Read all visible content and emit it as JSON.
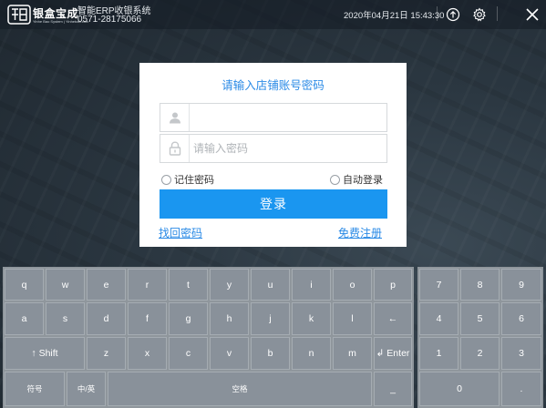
{
  "titlebar": {
    "brand_name": "银盒宝成",
    "brand_sub": "Yinhe Bao System | Yinhebao.com",
    "app_name": "智能ERP收银系统",
    "phone": "0571-28175066",
    "datetime": "2020年04月21日 15:43:30",
    "upload_icon": "upload-circle-icon",
    "settings_icon": "gear-icon",
    "close_icon": "close-icon"
  },
  "login": {
    "title": "请输入店铺账号密码",
    "username_value": "",
    "username_placeholder": "",
    "password_value": "",
    "password_placeholder": "请输入密码",
    "remember_label": "记住密码",
    "auto_login_label": "自动登录",
    "login_button": "登录",
    "forgot_link": "找回密码",
    "register_link": "免费注册"
  },
  "keyboard": {
    "row1": [
      "q",
      "w",
      "e",
      "r",
      "t",
      "y",
      "u",
      "i",
      "o",
      "p"
    ],
    "row2": [
      "a",
      "s",
      "d",
      "f",
      "g",
      "h",
      "j",
      "k",
      "l",
      "←"
    ],
    "shift": "↑ Shift",
    "row3": [
      "z",
      "x",
      "c",
      "v",
      "b",
      "n",
      "m"
    ],
    "enter": "↲ Enter",
    "symbols": "符号",
    "lang_toggle": "中/英",
    "space": "空格",
    "underscore": "_"
  },
  "numpad": {
    "rows": [
      [
        "7",
        "8",
        "9"
      ],
      [
        "4",
        "5",
        "6"
      ],
      [
        "1",
        "2",
        "3"
      ]
    ],
    "zero": "0",
    "dot": "."
  },
  "colors": {
    "accent": "#1a96f0",
    "link": "#2a8ae6",
    "key_bg": "#89919a",
    "keyboard_bg": "#8f969c"
  }
}
